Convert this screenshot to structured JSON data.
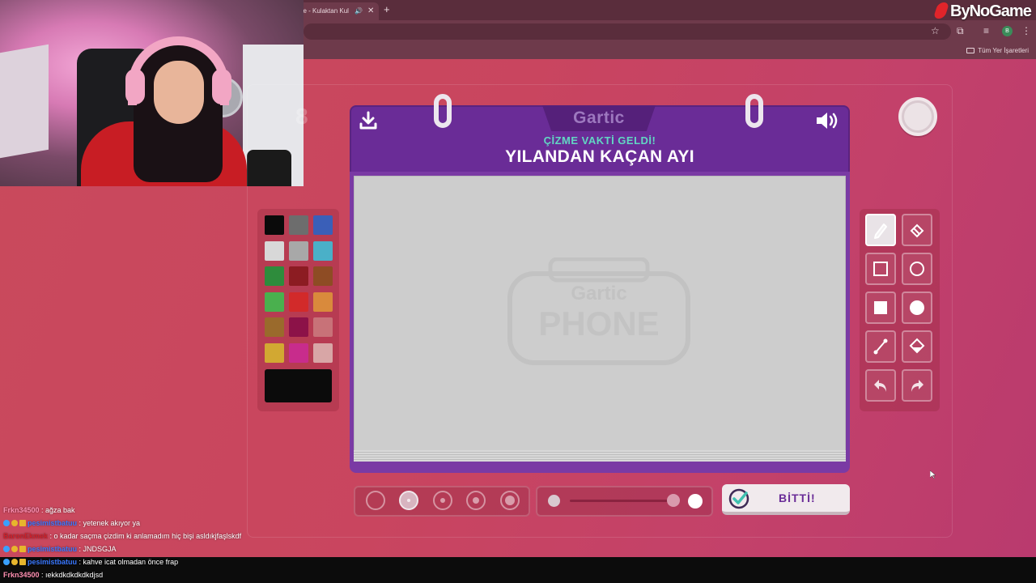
{
  "browser": {
    "tab_title": "ne - Kulaktan Kul",
    "bookmarks_all": "Tüm Yer İşaretleri",
    "profile_initial": "B"
  },
  "brand": {
    "name": "ByNoGame"
  },
  "game": {
    "logo": "Gartic",
    "subtitle": "ÇİZME VAKTİ GELDİ!",
    "prompt": "YILANDAN KAÇAN AYI",
    "done_label": "BİTTİ!",
    "watermark_top": "Gartic",
    "watermark_bottom": "PHONE",
    "faded_left_glyph": "8",
    "colors": [
      "#0a0a0a",
      "#6d6d6d",
      "#3a5fb8",
      "#d8d8d8",
      "#a8a8a8",
      "#4ab0c8",
      "#2e8c3c",
      "#8c1c22",
      "#8e4c24",
      "#4ab04e",
      "#d22a2a",
      "#d98a3c",
      "#9a6a2c",
      "#8c1248",
      "#c87278",
      "#d2a832",
      "#c82c8c",
      "#d8a6a6"
    ],
    "selected_color": "#0b0b0b",
    "tools": [
      "pencil",
      "eraser",
      "rectangle-outline",
      "circle-outline",
      "rectangle-filled",
      "circle-filled",
      "line",
      "fill-bucket",
      "undo",
      "redo"
    ],
    "selected_tool": "pencil",
    "brush_sizes_selected_index": 1
  },
  "chat": [
    {
      "user": "Frkn34500",
      "user_color": "#ff8fb1",
      "badges": [],
      "message": "ağza bak"
    },
    {
      "user": "pesimistbatuu",
      "user_color": "#3a78ff",
      "badges": [
        "check",
        "gold",
        "crown"
      ],
      "message": "yetenek akıyor ya"
    },
    {
      "user": "BaronEkmek",
      "user_color": "#d0202a",
      "badges": [],
      "message": "o kadar saçma çizdim ki anlamadım hiç bişi asldıkjfaşlskdf"
    },
    {
      "user": "pesimistbatuu",
      "user_color": "#3a78ff",
      "badges": [
        "check",
        "gold",
        "crown"
      ],
      "message": "JNDSGJA"
    },
    {
      "user": "pesimistbatuu",
      "user_color": "#3a78ff",
      "badges": [
        "check",
        "gold",
        "crown"
      ],
      "message": "kahve icat olmadan önce frap"
    },
    {
      "user": "Frkn34500",
      "user_color": "#ff8fb1",
      "badges": [],
      "message": "ıekkdkdkdkdkdjsd"
    }
  ]
}
